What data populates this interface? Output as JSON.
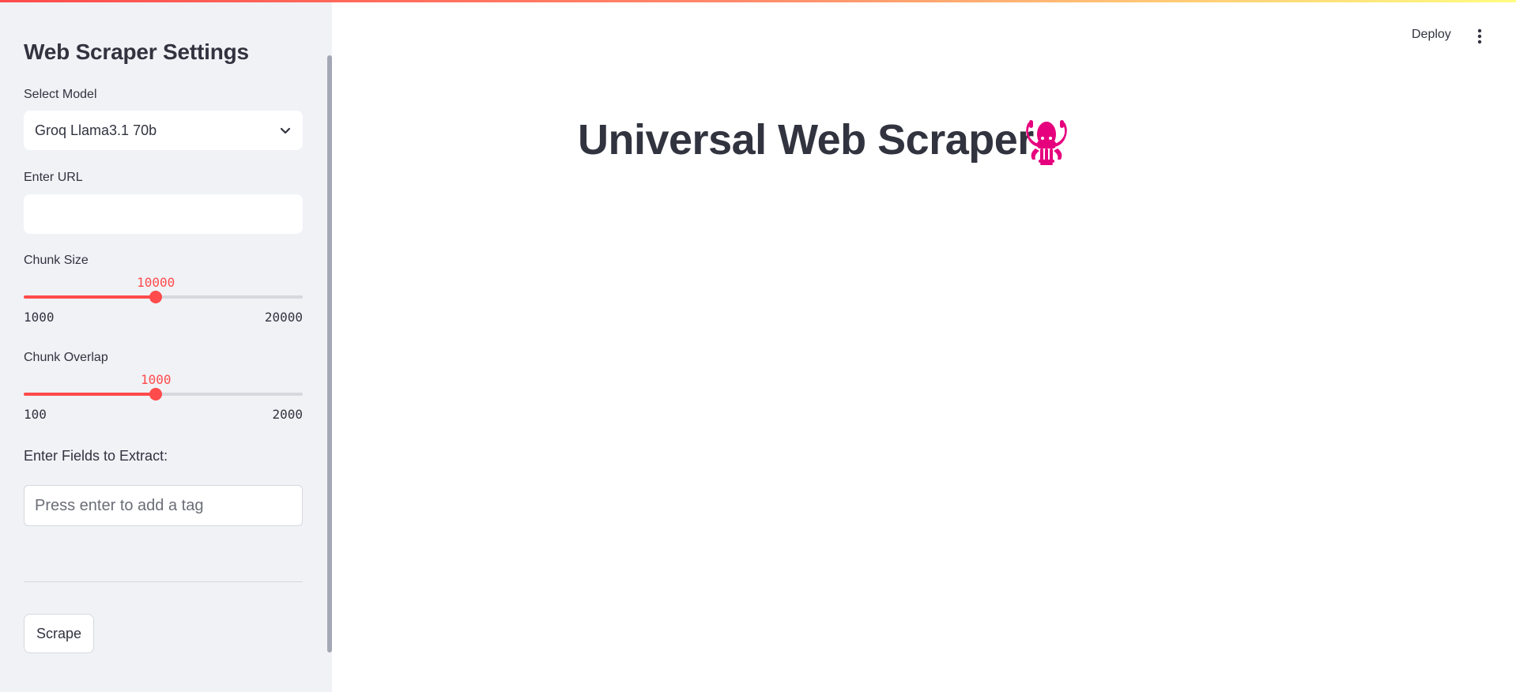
{
  "sidebar": {
    "title": "Web Scraper Settings",
    "model": {
      "label": "Select Model",
      "value": "Groq Llama3.1 70b"
    },
    "url": {
      "label": "Enter URL",
      "value": ""
    },
    "chunk_size": {
      "label": "Chunk Size",
      "value": "10000",
      "min": "1000",
      "max": "20000",
      "fraction": 0.4737
    },
    "chunk_overlap": {
      "label": "Chunk Overlap",
      "value": "1000",
      "min": "100",
      "max": "2000",
      "fraction": 0.4737
    },
    "fields": {
      "label": "Enter Fields to Extract:",
      "placeholder": "Press enter to add a tag"
    },
    "scrape_label": "Scrape"
  },
  "header": {
    "deploy_label": "Deploy",
    "menu_icon": "kebab-vertical-icon"
  },
  "main": {
    "title": "Universal Web Scraper",
    "title_icon": "squid-emoji-icon"
  },
  "colors": {
    "accent": "#ff4b4b",
    "sidebar_bg": "#f0f2f6",
    "text": "#31333f",
    "squid": "#e6007e"
  }
}
